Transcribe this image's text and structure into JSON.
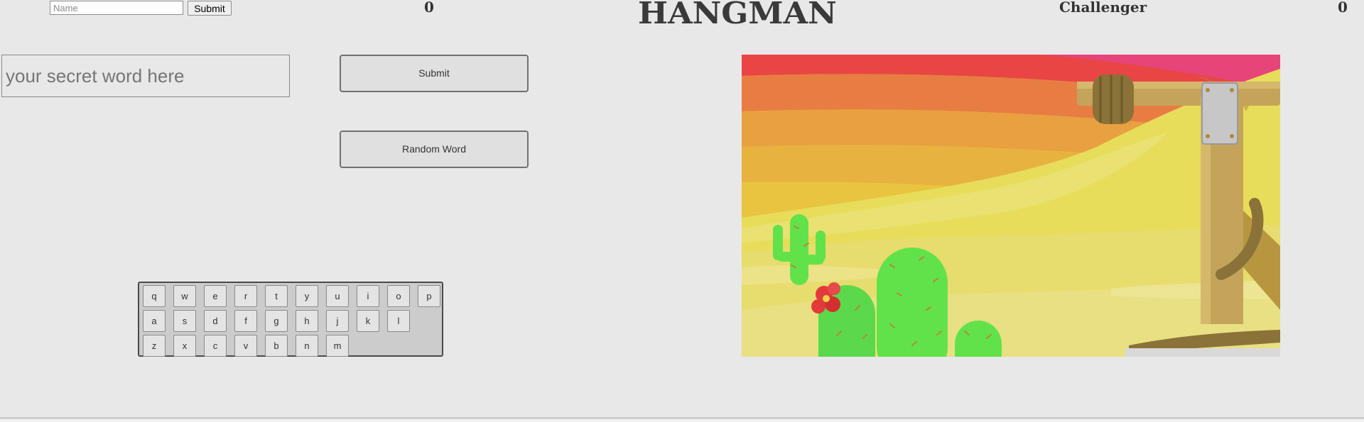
{
  "header": {
    "name_placeholder": "Name",
    "name_submit_label": "Submit",
    "player_score": "0",
    "title": "HANGMAN",
    "challenger_label": "Challenger",
    "challenger_score": "0"
  },
  "word_entry": {
    "placeholder": "your secret word here",
    "submit_label": "Submit",
    "random_label": "Random Word"
  },
  "keyboard": {
    "rows": [
      [
        "q",
        "w",
        "e",
        "r",
        "t",
        "y",
        "u",
        "i",
        "o",
        "p"
      ],
      [
        "a",
        "s",
        "d",
        "f",
        "g",
        "h",
        "j",
        "k",
        "l"
      ],
      [
        "z",
        "x",
        "c",
        "v",
        "b",
        "n",
        "m"
      ]
    ]
  },
  "scene": {
    "colors": {
      "sky_top": "#e94545",
      "sky_pink": "#e6457a",
      "band_orange": "#e87d43",
      "band_amber": "#e9a040",
      "band_gold": "#e9c440",
      "sand": "#e8df5a",
      "sand_light": "#ebe07a",
      "cactus": "#62e24a",
      "flower": "#e23a3a",
      "wood": "#c4a45a",
      "rope": "#8a7238"
    }
  }
}
